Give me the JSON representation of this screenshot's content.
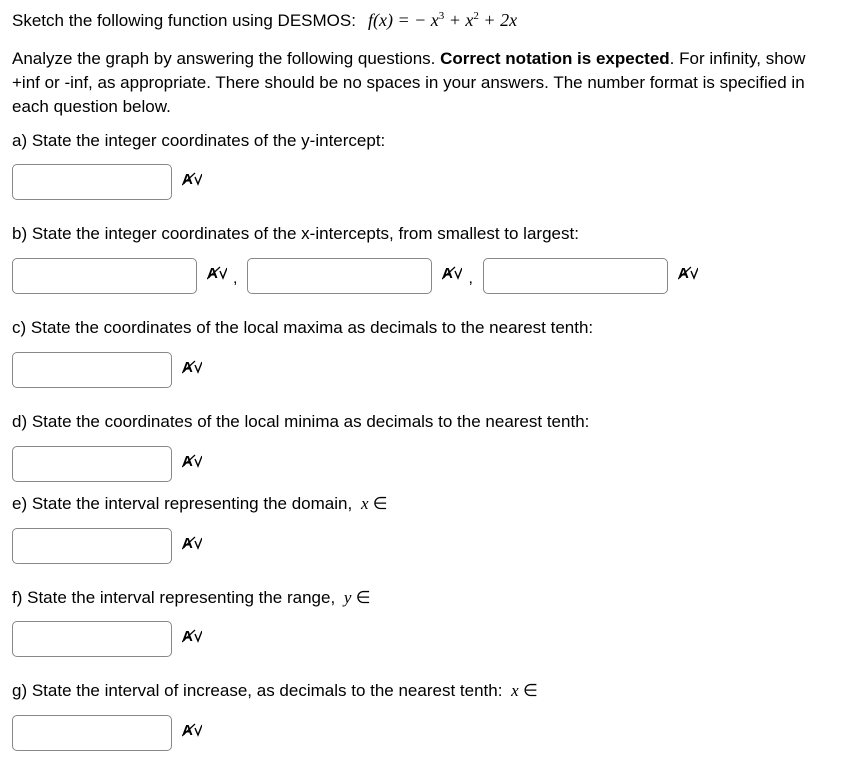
{
  "intro": {
    "text": "Sketch the following function using DESMOS:",
    "function_html": "f(x) = − x³ + x² + 2x"
  },
  "instructions": {
    "part1": "Analyze the graph by answering the following questions. ",
    "bold": "Correct notation is expected",
    "part2": ". For infinity, show +inf or -inf, as appropriate. There should be no spaces in your answers. The number format is specified in each question below."
  },
  "questions": {
    "a": "a) State the integer coordinates of the y-intercept:",
    "b": "b) State the integer coordinates of the x-intercepts, from smallest to largest:",
    "c": "c) State the coordinates of the local maxima as decimals to the nearest tenth:",
    "d": "d) State the coordinates of the local minima as decimals to the nearest tenth:",
    "e": "e) State the interval representing the domain, ",
    "e_math": "x ∈",
    "f": "f) State the interval representing the range, ",
    "f_math": "y ∈",
    "g": "g) State the interval of increase, as decimals to the nearest tenth: ",
    "g_math": "x ∈"
  },
  "check_glyph": "A̷ ̸"
}
